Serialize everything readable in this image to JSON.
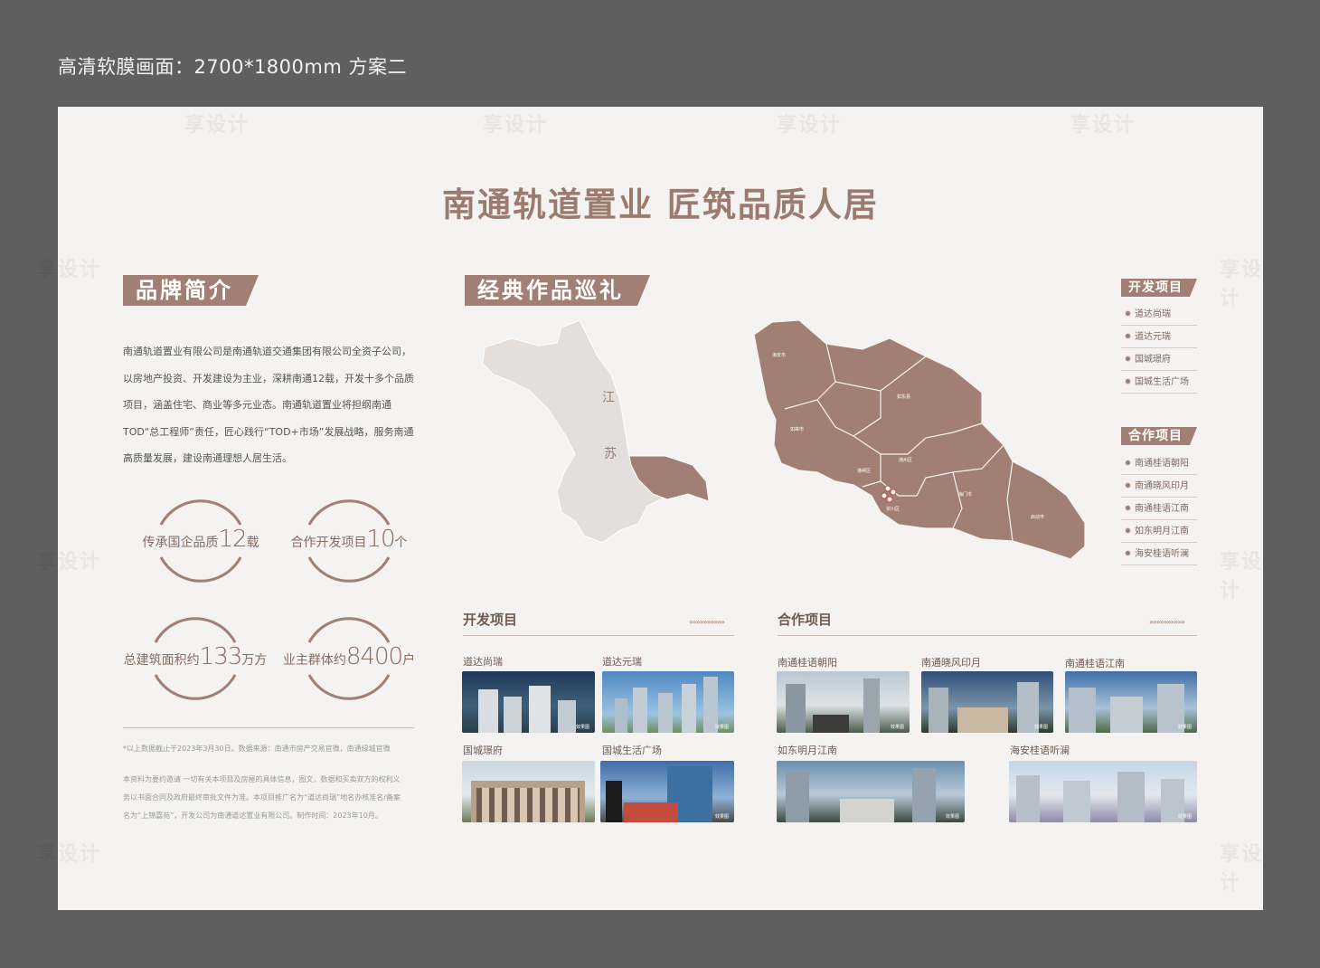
{
  "top_caption": "高清软膜画面：2700*1800mm   方案二",
  "title": "南通轨道置业  匠筑品质人居",
  "brand": {
    "tag": "品牌简介",
    "paragraph": "南通轨道置业有限公司是南通轨道交通集团有限公司全资子公司，以房地产投资、开发建设为主业，深耕南通12载，开发十多个品质项目，涵盖住宅、商业等多元业态。南通轨道置业将担纲南通TOD“总工程师”责任，匠心践行“TOD+市场”发展战略，服务南通高质量发展，建设南通理想人居生活。"
  },
  "stats": [
    {
      "prefix": "传承国企品质",
      "number": "12",
      "unit": "载"
    },
    {
      "prefix": "合作开发项目",
      "number": "10",
      "unit": "个"
    },
    {
      "prefix": "总建筑面积约",
      "number": "133",
      "unit": "万方"
    },
    {
      "prefix": "业主群体约",
      "number": "8400",
      "unit": "户"
    }
  ],
  "footnotes": {
    "line1": "*以上数据截止于2023年3月30日。数据来源：南通市房产交易官微，南通绿城官微",
    "line2": "本资料为要约邀请 一切有关本项目及房屋的具体信息，图文，数据和买卖双方的权利义",
    "line3": "务以书面合同及政府最终审批文件为准。本项目推广名为“道达尚瑞”地名办核准名/备案",
    "line4": "名为“上锦嘉苑”，开发公司为南通道达置业有限公司。制作时间：2023年10月。"
  },
  "works": {
    "tag": "经典作品巡礼",
    "map_labels": {
      "jiang": "江",
      "su": "苏",
      "haian": "海安市",
      "rugao": "如皋市",
      "rudong": "如东县",
      "tongzhou": "通州区",
      "chongchuan": "崇川区",
      "gangzha": "港闸区",
      "haimen": "海门市",
      "qidong": "启动市"
    }
  },
  "legend": {
    "dev_tag": "开发项目",
    "dev_items": [
      "道达尚瑞",
      "道达元瑞",
      "国城璟府",
      "国城生活广场"
    ],
    "coop_tag": "合作项目",
    "coop_items": [
      "南通桂语朝阳",
      "南通晓风印月",
      "南通桂语江南",
      "如东明月江南",
      "海安桂语听澜"
    ]
  },
  "dev_section": {
    "heading": "开发项目",
    "arrows": "»»»»»»»»»»",
    "projects": [
      "道达尚瑞",
      "道达元瑞",
      "国城璟府",
      "国城生活广场"
    ]
  },
  "coop_section": {
    "heading": "合作项目",
    "arrows": "»»»»»»»»»»",
    "projects": [
      "南通桂语朝阳",
      "南通晓风印月",
      "南通桂语江南",
      "如东明月江南",
      "海安桂语听澜"
    ]
  },
  "photo_tag": "效果图",
  "watermark": "享设计",
  "colors": {
    "accent": "#a17f74",
    "map_fill": "#a17f74",
    "province_fill": "#e4dfdb",
    "background": "#5f5f5f",
    "board": "#f4f3f1"
  }
}
